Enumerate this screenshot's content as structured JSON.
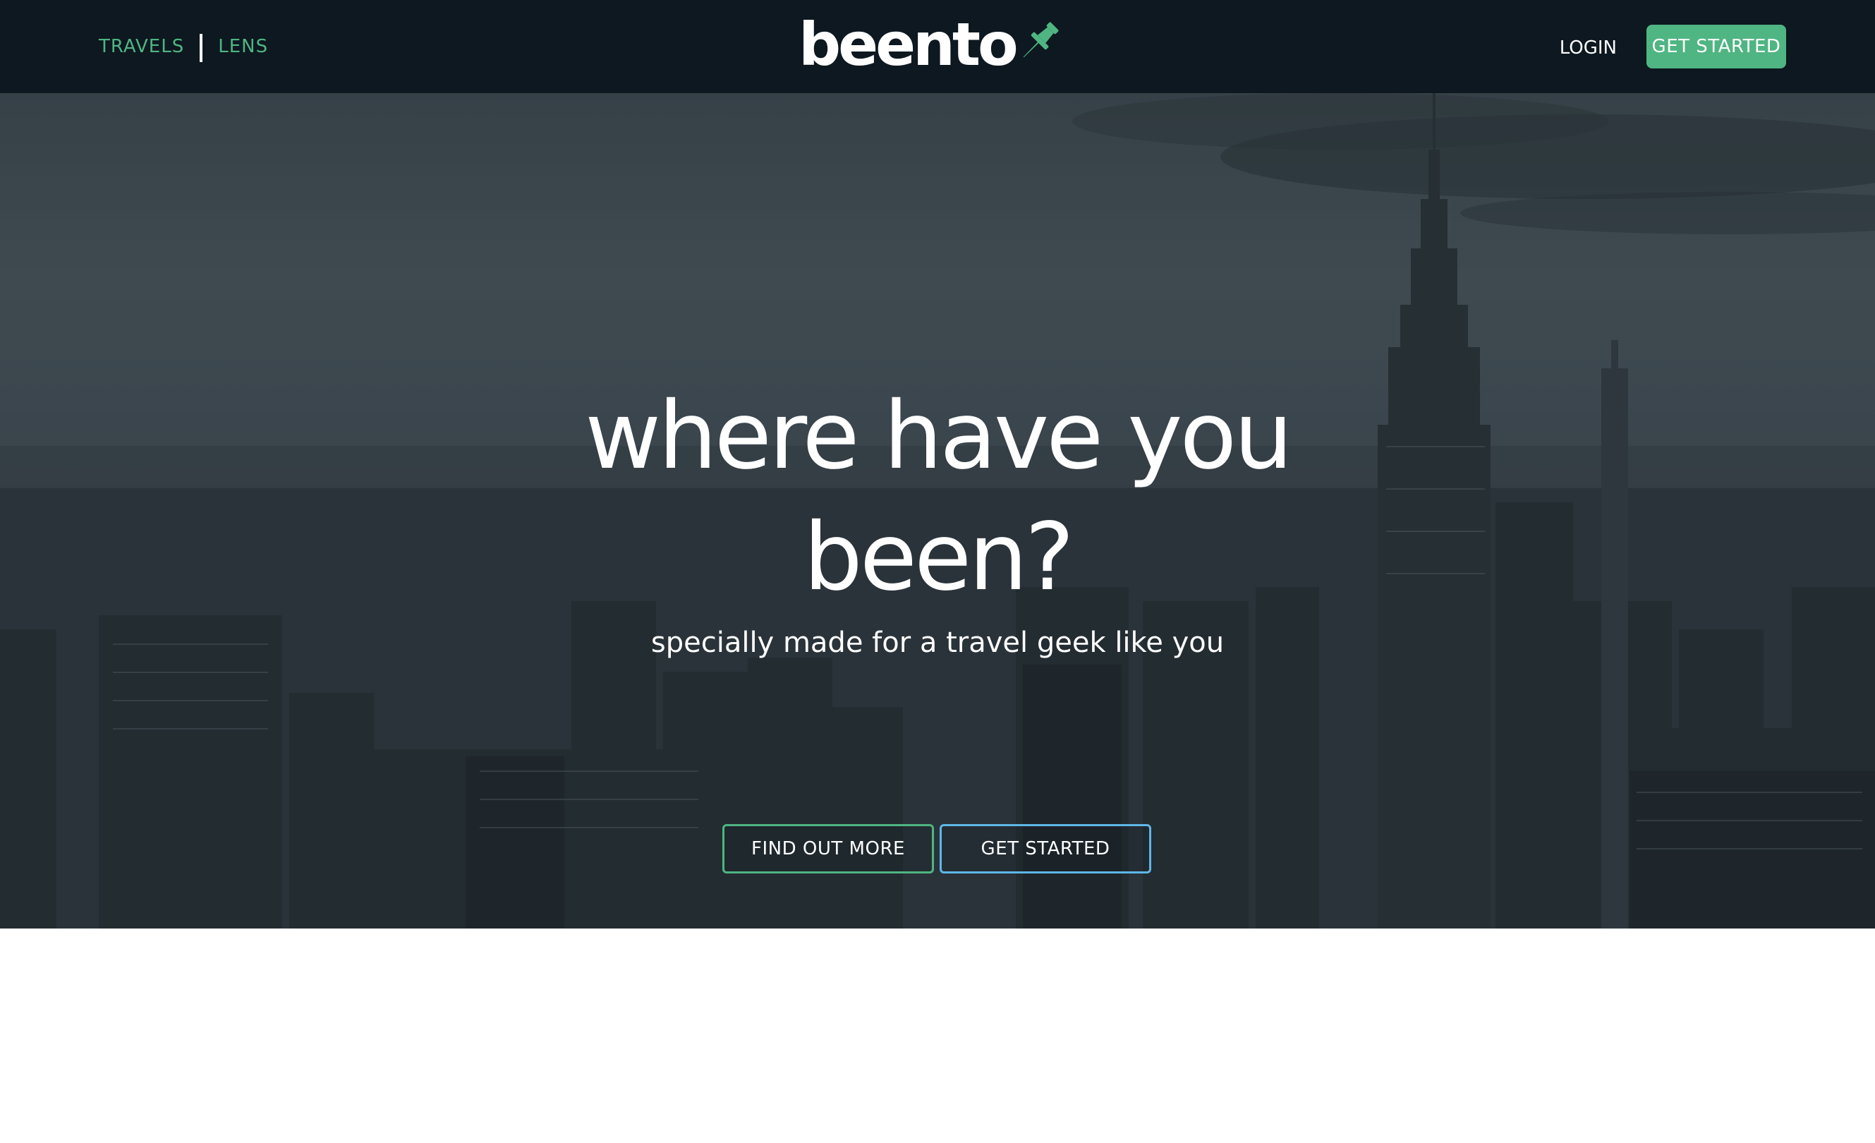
{
  "nav": {
    "left_links": [
      "TRAVELS",
      "LENS"
    ],
    "brand": "beento",
    "login_label": "LOGIN",
    "get_started_label": "GET STARTED"
  },
  "hero": {
    "headline": "where have you been?",
    "subtitle": "specially made for a travel geek like you",
    "find_out_more_label": "FIND OUT MORE",
    "get_started_label": "GET STARTED"
  },
  "colors": {
    "navbar_bg": "#0d1820",
    "accent_green": "#4fb582",
    "accent_blue": "#5fb7e8"
  }
}
